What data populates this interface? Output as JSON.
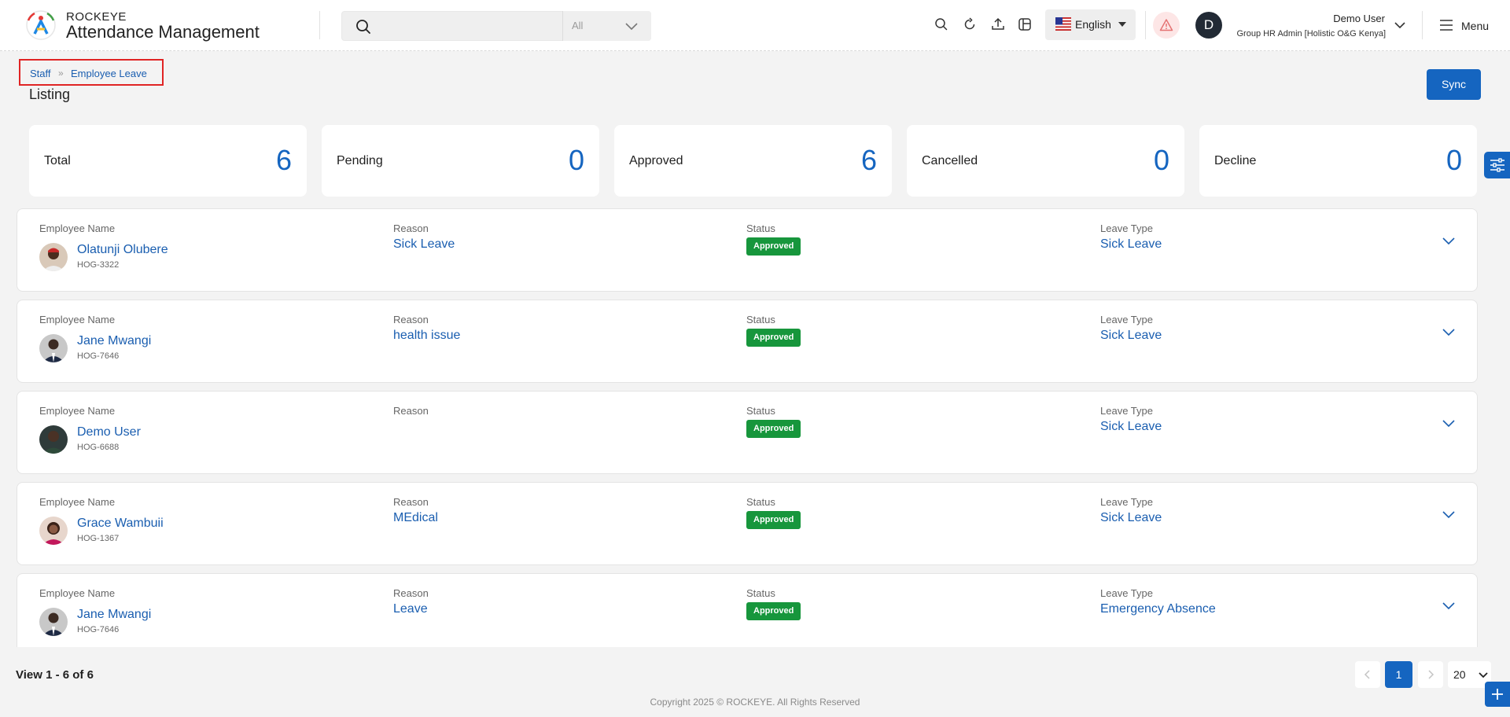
{
  "header": {
    "brand_top": "ROCKEYE",
    "brand_main": "Attendance Management",
    "search": {
      "placeholder": "",
      "scope": "All"
    },
    "language": "English",
    "user": {
      "initial": "D",
      "name": "Demo User",
      "role": "Group HR Admin [Holistic O&G Kenya]"
    },
    "menu_label": "Menu"
  },
  "breadcrumb": {
    "items": [
      "Staff",
      "Employee Leave"
    ]
  },
  "page_title": "Listing",
  "sync_label": "Sync",
  "stats": [
    {
      "label": "Total",
      "value": "6"
    },
    {
      "label": "Pending",
      "value": "0"
    },
    {
      "label": "Approved",
      "value": "6"
    },
    {
      "label": "Cancelled",
      "value": "0"
    },
    {
      "label": "Decline",
      "value": "0"
    }
  ],
  "labels": {
    "employee_name": "Employee Name",
    "reason": "Reason",
    "status": "Status",
    "leave_type": "Leave Type"
  },
  "rows": [
    {
      "name": "Olatunji Olubere",
      "code": "HOG-3322",
      "reason": "Sick Leave",
      "status": "Approved",
      "leave_type": "Sick Leave"
    },
    {
      "name": "Jane Mwangi",
      "code": "HOG-7646",
      "reason": "health issue",
      "status": "Approved",
      "leave_type": "Sick Leave"
    },
    {
      "name": "Demo User",
      "code": "HOG-6688",
      "reason": "",
      "status": "Approved",
      "leave_type": "Sick Leave"
    },
    {
      "name": "Grace Wambuii",
      "code": "HOG-1367",
      "reason": "MEdical",
      "status": "Approved",
      "leave_type": "Sick Leave"
    },
    {
      "name": "Jane Mwangi",
      "code": "HOG-7646",
      "reason": "Leave",
      "status": "Approved",
      "leave_type": "Emergency Absence"
    }
  ],
  "footer": {
    "view_count": "View 1 - 6 of 6",
    "current_page": "1",
    "page_size": "20",
    "copyright": "Copyright 2025 © ROCKEYE. All Rights Reserved"
  },
  "colors": {
    "accent": "#1565c0",
    "link": "#1a5eb0",
    "approved": "#17963c",
    "highlight_border": "#e02424"
  }
}
